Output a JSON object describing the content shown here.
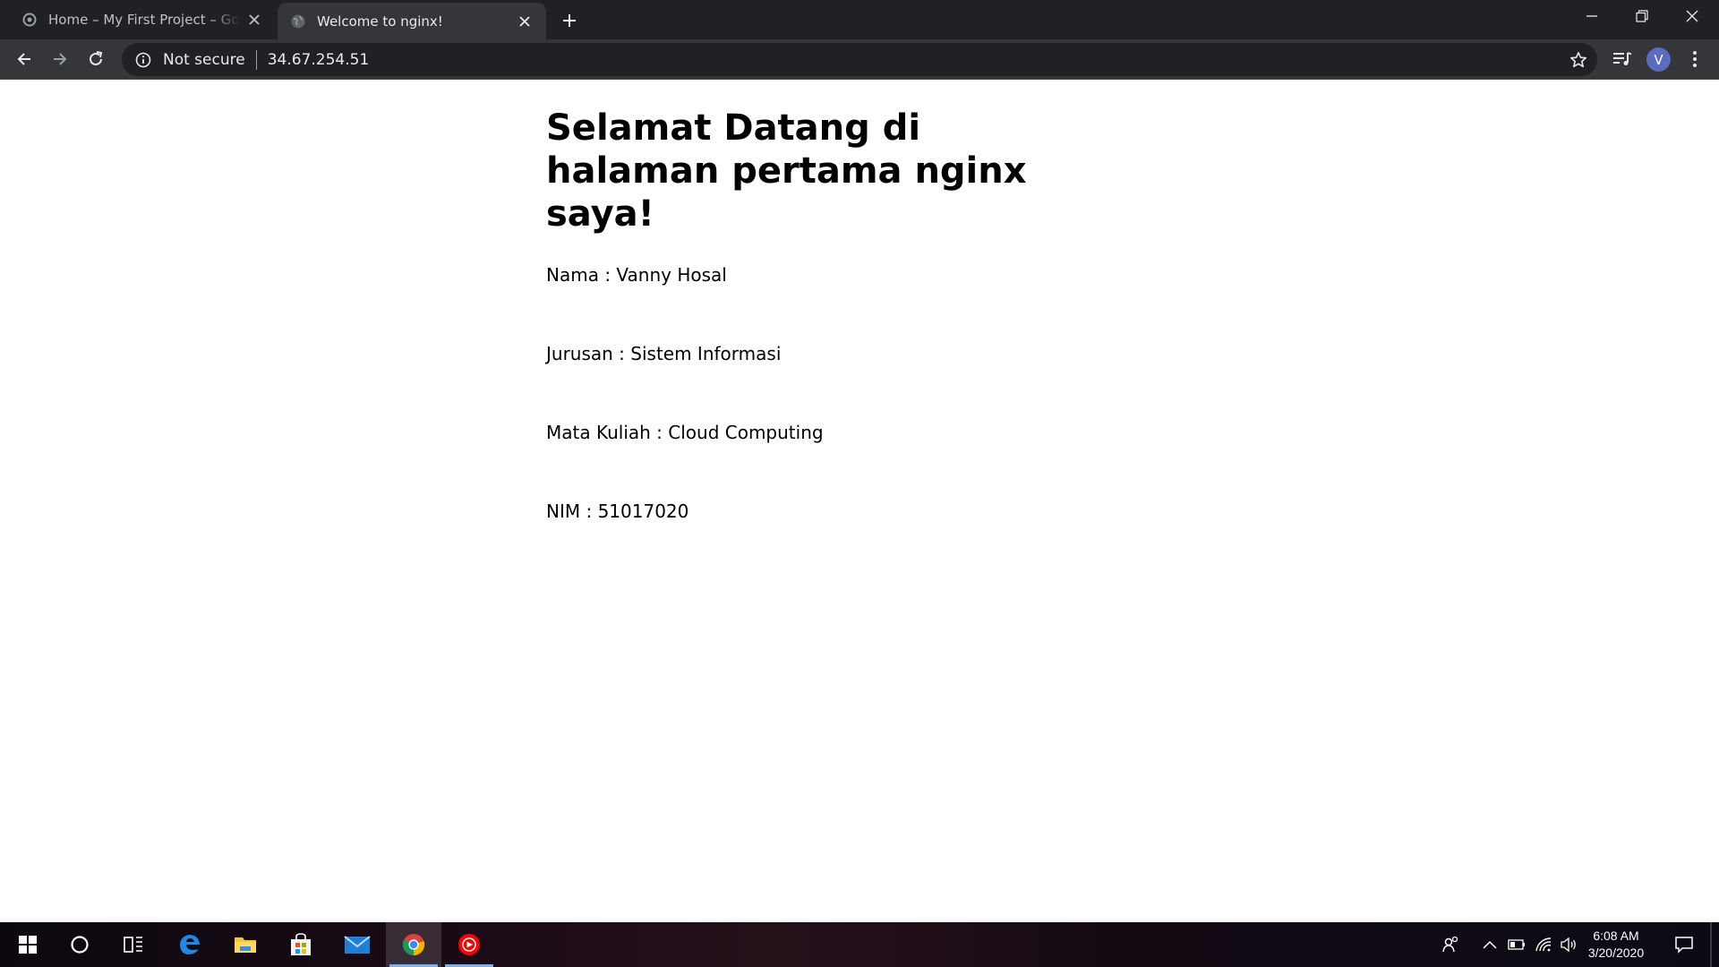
{
  "browser": {
    "tabs": [
      {
        "title": "Home – My First Project – Google Cloud Platform",
        "active": false,
        "favicon": "gcp-icon"
      },
      {
        "title": "Welcome to nginx!",
        "active": true,
        "favicon": "globe-icon"
      }
    ],
    "security_label": "Not secure",
    "url": "34.67.254.51",
    "profile_initial": "V"
  },
  "page": {
    "heading": "Selamat Datang di halaman pertama nginx saya!",
    "lines": [
      "Nama : Vanny Hosal",
      "Jurusan : Sistem Informasi",
      "Mata Kuliah : Cloud Computing",
      "NIM : 51017020"
    ]
  },
  "taskbar": {
    "apps": [
      "windows-start-icon",
      "cortana-search-icon",
      "task-view-icon",
      "edge-icon",
      "file-explorer-icon",
      "microsoft-store-icon",
      "mail-icon",
      "chrome-icon",
      "youtube-music-icon"
    ],
    "time": "6:08 AM",
    "date": "3/20/2020"
  },
  "colors": {
    "tabstrip": "#202124",
    "toolbar": "#35363a",
    "omnibox": "#202124",
    "avatar": "#5b6bbf"
  }
}
